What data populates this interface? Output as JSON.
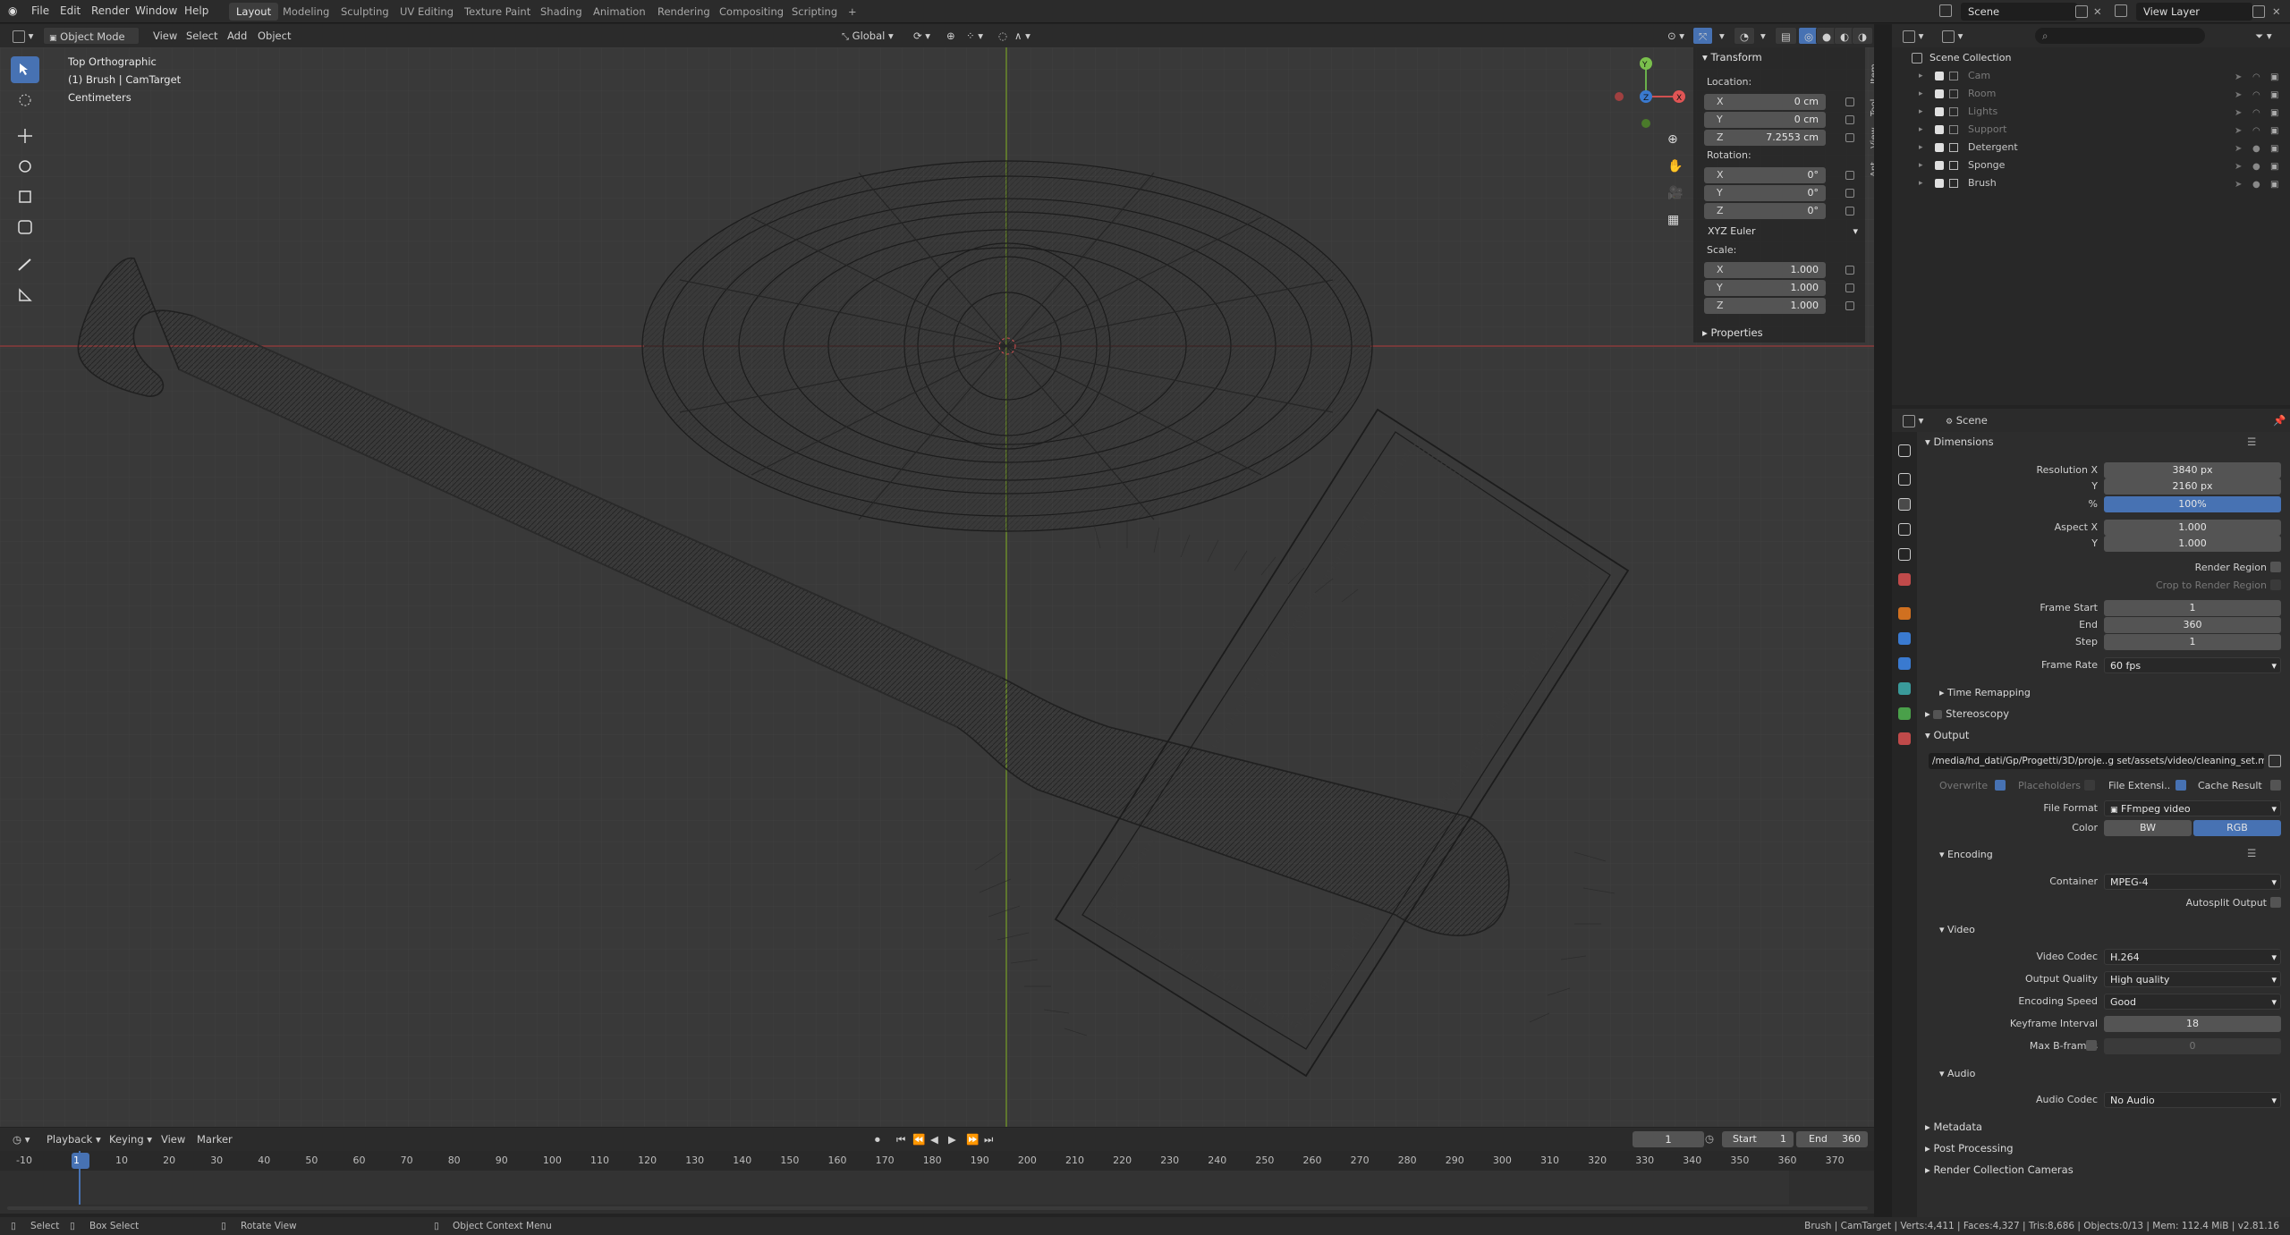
{
  "topbar": {
    "menus": [
      "File",
      "Edit",
      "Render",
      "Window",
      "Help"
    ],
    "workspaces": [
      "Layout",
      "Modeling",
      "Sculpting",
      "UV Editing",
      "Texture Paint",
      "Shading",
      "Animation",
      "Rendering",
      "Compositing",
      "Scripting"
    ],
    "active_workspace": "Layout",
    "add_tab": "+",
    "scene": "Scene",
    "view_layer": "View Layer"
  },
  "viewport_header": {
    "mode": "Object Mode",
    "menus": [
      "View",
      "Select",
      "Add",
      "Object"
    ],
    "orientation": "Global"
  },
  "viewport": {
    "view_name": "Top Orthographic",
    "object_info": "(1) Brush | CamTarget",
    "units": "Centimeters"
  },
  "npanel": {
    "transform_title": "Transform",
    "location_label": "Location:",
    "location": [
      {
        "axis": "X",
        "value": "0 cm"
      },
      {
        "axis": "Y",
        "value": "0 cm"
      },
      {
        "axis": "Z",
        "value": "7.2553 cm"
      }
    ],
    "rotation_label": "Rotation:",
    "rotation": [
      {
        "axis": "X",
        "value": "0°"
      },
      {
        "axis": "Y",
        "value": "0°"
      },
      {
        "axis": "Z",
        "value": "0°"
      }
    ],
    "rotation_mode": "XYZ Euler",
    "scale_label": "Scale:",
    "scale": [
      {
        "axis": "X",
        "value": "1.000"
      },
      {
        "axis": "Y",
        "value": "1.000"
      },
      {
        "axis": "Z",
        "value": "1.000"
      }
    ],
    "properties_title": "Properties",
    "tabs": [
      "Item",
      "Tool",
      "View",
      "Ant"
    ]
  },
  "outliner": {
    "root": "Scene Collection",
    "items": [
      {
        "name": "Cam",
        "dim": true
      },
      {
        "name": "Room",
        "dim": true
      },
      {
        "name": "Lights",
        "dim": true
      },
      {
        "name": "Support",
        "dim": true
      },
      {
        "name": "Detergent",
        "dim": false
      },
      {
        "name": "Sponge",
        "dim": false
      },
      {
        "name": "Brush",
        "dim": false
      }
    ]
  },
  "properties": {
    "header": "Scene",
    "dimensions": {
      "title": "Dimensions",
      "resolution_x_label": "Resolution X",
      "resolution_x": "3840 px",
      "y_label": "Y",
      "resolution_y": "2160 px",
      "pct_label": "%",
      "percent": "100%",
      "aspect_x_label": "Aspect X",
      "aspect_x": "1.000",
      "aspect_y_label": "Y",
      "aspect_y": "1.000",
      "render_region": "Render Region",
      "crop": "Crop to Render Region",
      "frame_start_label": "Frame Start",
      "frame_start": "1",
      "end_label": "End",
      "end": "360",
      "step_label": "Step",
      "step": "1",
      "frame_rate_label": "Frame Rate",
      "frame_rate": "60 fps"
    },
    "time_remapping": "Time Remapping",
    "stereoscopy": "Stereoscopy",
    "output": {
      "title": "Output",
      "path": "/media/hd_dati/Gp/Progetti/3D/proje..g set/assets/video/cleaning_set.mp4",
      "overwrite": "Overwrite",
      "placeholders": "Placeholders",
      "file_extension": "File Extensi..",
      "cache_result": "Cache Result",
      "file_format_label": "File Format",
      "file_format": "FFmpeg video",
      "color_label": "Color",
      "color_bw": "BW",
      "color_rgb": "RGB"
    },
    "encoding": {
      "title": "Encoding",
      "container_label": "Container",
      "container": "MPEG-4",
      "autosplit": "Autosplit Output",
      "video_title": "Video",
      "video_codec_label": "Video Codec",
      "video_codec": "H.264",
      "output_quality_label": "Output Quality",
      "output_quality": "High quality",
      "encoding_speed_label": "Encoding Speed",
      "encoding_speed": "Good",
      "keyframe_label": "Keyframe Interval",
      "keyframe": "18",
      "bframes_label": "Max B-frames",
      "bframes": "0",
      "audio_title": "Audio",
      "audio_codec_label": "Audio Codec",
      "audio_codec": "No Audio"
    },
    "metadata": "Metadata",
    "post_processing": "Post Processing",
    "render_collection_cameras": "Render Collection Cameras"
  },
  "timeline": {
    "menus": [
      "Playback",
      "Keying",
      "View",
      "Marker"
    ],
    "current_frame": "1",
    "start_label": "Start",
    "start": "1",
    "end_label": "End",
    "end": "360",
    "ticks": [
      "-10",
      "1",
      "10",
      "20",
      "30",
      "40",
      "50",
      "60",
      "70",
      "80",
      "90",
      "100",
      "110",
      "120",
      "130",
      "140",
      "150",
      "160",
      "170",
      "180",
      "190",
      "200",
      "210",
      "220",
      "230",
      "240",
      "250",
      "260",
      "270",
      "280",
      "290",
      "300",
      "310",
      "320",
      "330",
      "340",
      "350",
      "360",
      "370"
    ]
  },
  "statusbar": {
    "select": "Select",
    "box_select": "Box Select",
    "rotate_view": "Rotate View",
    "context_menu": "Object Context Menu",
    "stats": "Brush | CamTarget | Verts:4,411 | Faces:4,327 | Tris:8,686 | Objects:0/13 | Mem: 112.4 MiB | v2.81.16"
  }
}
